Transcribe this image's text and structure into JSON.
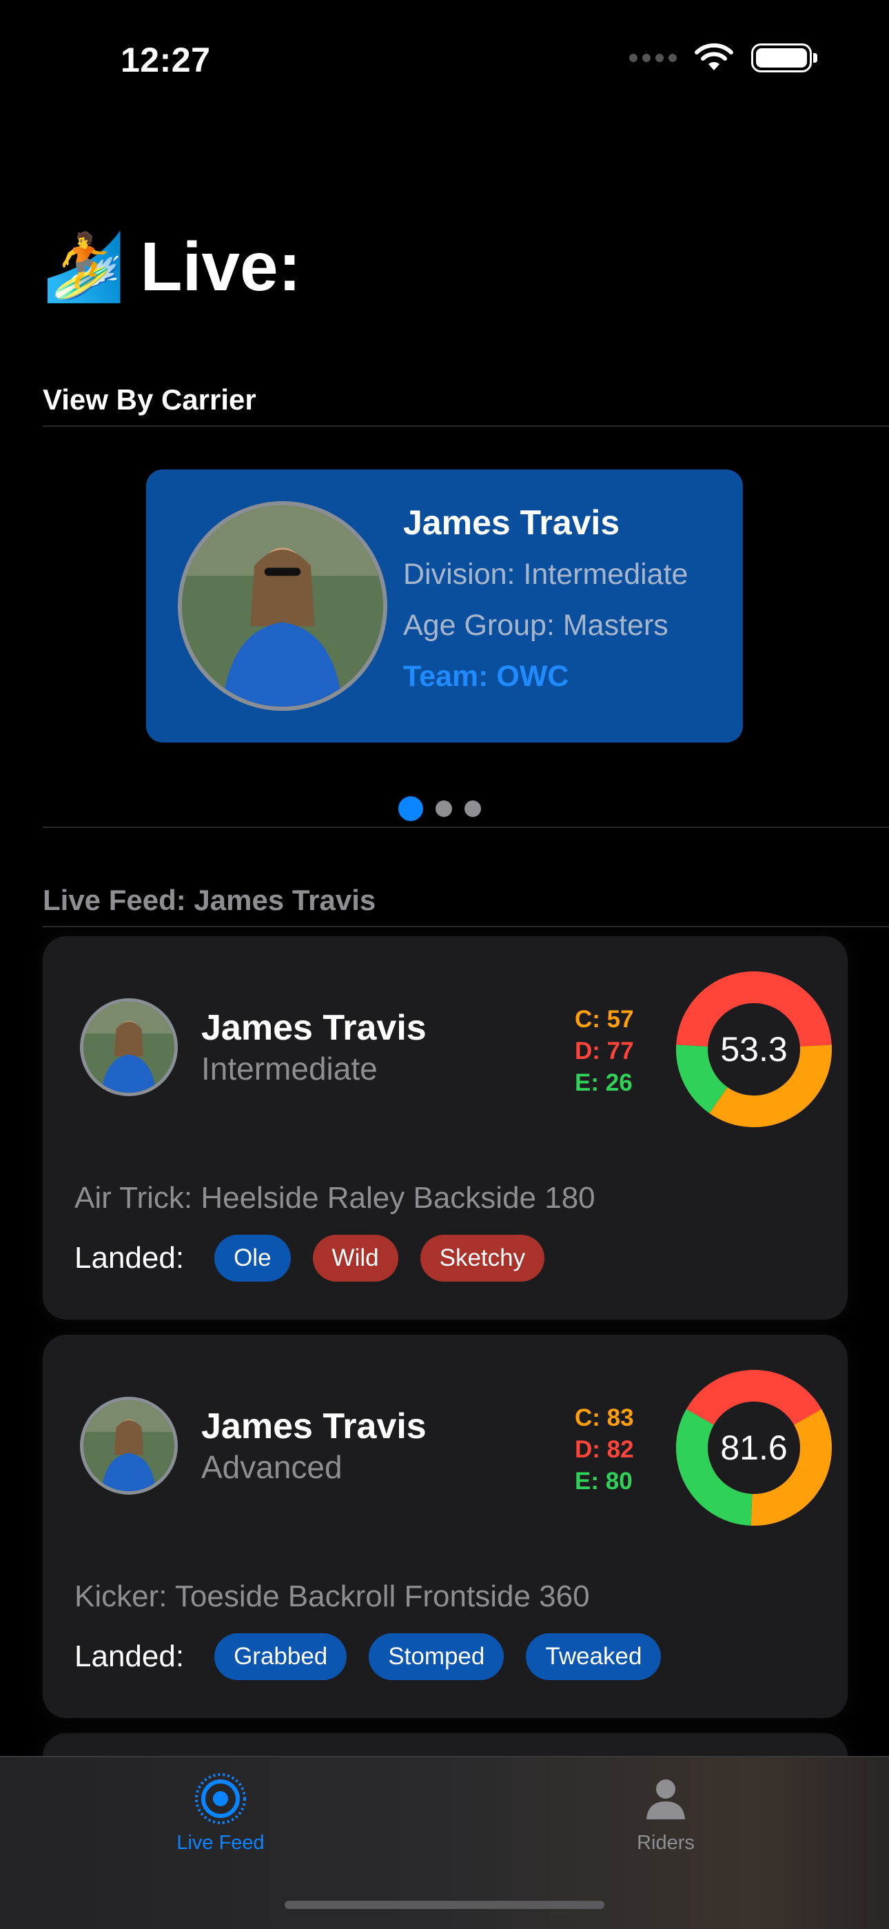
{
  "status_bar": {
    "time": "12:27"
  },
  "header": {
    "emoji": "🏄",
    "title": "Live:"
  },
  "carrier_section": {
    "title": "View By Carrier",
    "card": {
      "name": "James Travis",
      "division": "Division: Intermediate",
      "age_group": "Age Group: Masters",
      "team": "Team: OWC"
    },
    "page_count": 3,
    "active_page": 1
  },
  "feed_section": {
    "title": "Live Feed: James Travis",
    "items": [
      {
        "name": "James Travis",
        "division": "Intermediate",
        "c": "C: 57",
        "d": "D: 77",
        "e": "E: 26",
        "score": "53.3",
        "ring_values": {
          "c": 57,
          "d": 77,
          "e": 26
        },
        "trick": "Air Trick: Heelside Raley Backside 180",
        "landed_label": "Landed:",
        "tags": [
          {
            "label": "Ole",
            "color": "#0a56b0"
          },
          {
            "label": "Wild",
            "color": "#a9322b"
          },
          {
            "label": "Sketchy",
            "color": "#a9322b"
          }
        ]
      },
      {
        "name": "James Travis",
        "division": "Advanced",
        "c": "C: 83",
        "d": "D: 82",
        "e": "E: 80",
        "score": "81.6",
        "ring_values": {
          "c": 83,
          "d": 82,
          "e": 80
        },
        "trick": "Kicker: Toeside Backroll Frontside 360",
        "landed_label": "Landed:",
        "tags": [
          {
            "label": "Grabbed",
            "color": "#0a56b0"
          },
          {
            "label": "Stomped",
            "color": "#0a56b0"
          },
          {
            "label": "Tweaked",
            "color": "#0a56b0"
          }
        ]
      }
    ]
  },
  "tab_bar": {
    "tabs": [
      {
        "label": "Live Feed",
        "icon": "live-broadcast-icon",
        "active": true
      },
      {
        "label": "Riders",
        "icon": "person-icon",
        "active": false
      }
    ]
  },
  "colors": {
    "accent": "#0a84ff",
    "carrier_card": "#0a4f9e",
    "score_c": "#ff9f0a",
    "score_d": "#ff453a",
    "score_e": "#30d158"
  }
}
